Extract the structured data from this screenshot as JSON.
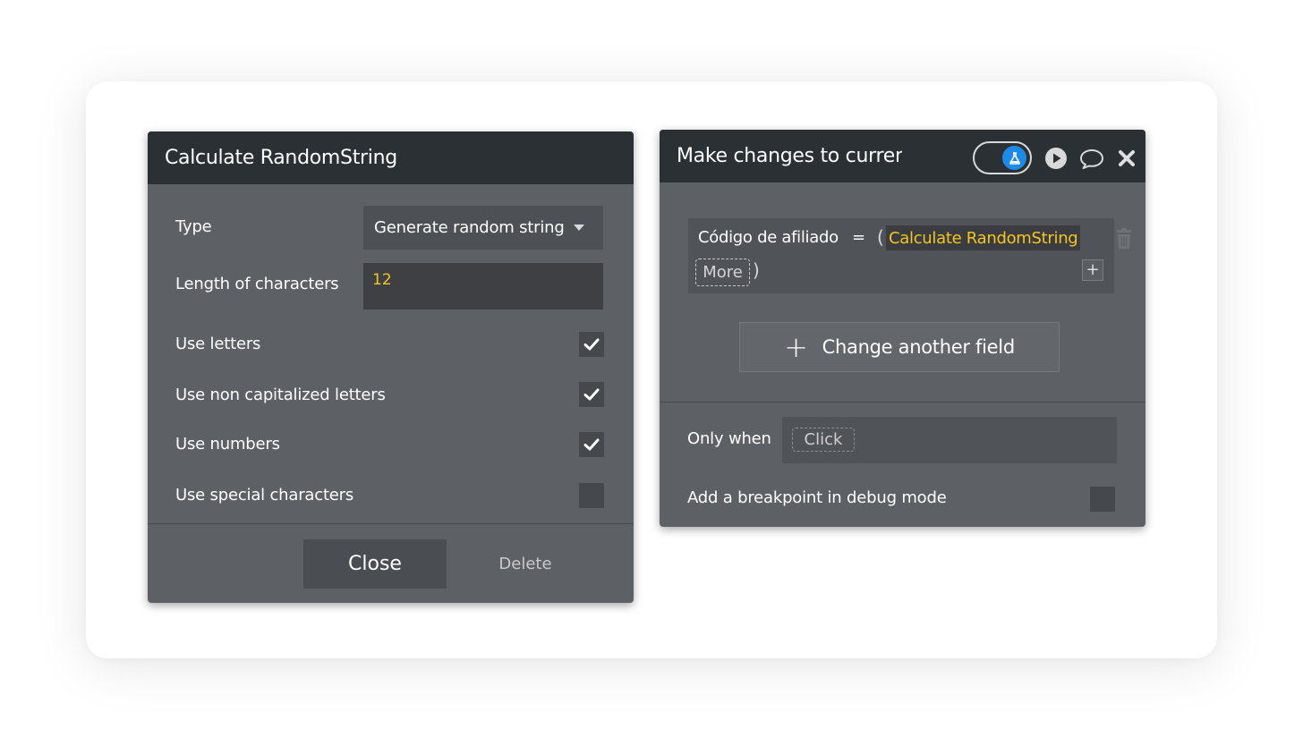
{
  "left_panel": {
    "title": "Calculate RandomString",
    "type_label": "Type",
    "type_value": "Generate random string",
    "length_label": "Length of characters",
    "length_value": "12",
    "options": [
      {
        "label": "Use letters",
        "checked": true
      },
      {
        "label": "Use non capitalized letters",
        "checked": true
      },
      {
        "label": "Use numbers",
        "checked": true
      },
      {
        "label": "Use special characters",
        "checked": false
      }
    ],
    "close_label": "Close",
    "delete_label": "Delete"
  },
  "right_panel": {
    "title": "Make changes to curren",
    "toggle_on": true,
    "field_name": "Código de afiliado",
    "field_operator": "=",
    "open_paren": "(",
    "expression": "Calculate RandomString",
    "more_label": "More",
    "close_paren": ")",
    "add_field_label": "Change another field",
    "only_when_label": "Only when",
    "only_when_placeholder": "Click",
    "breakpoint_label": "Add a breakpoint in debug mode",
    "breakpoint_checked": false
  },
  "colors": {
    "header_bg": "#2b3034",
    "panel_bg": "#5d6064",
    "expression_text": "#f3c623",
    "toggle_accent": "#1e8ae6"
  },
  "icons": [
    "dropdown-caret-icon",
    "checkmark-icon",
    "flask-icon",
    "play-icon",
    "comment-icon",
    "close-icon",
    "trash-icon",
    "plus-icon"
  ]
}
